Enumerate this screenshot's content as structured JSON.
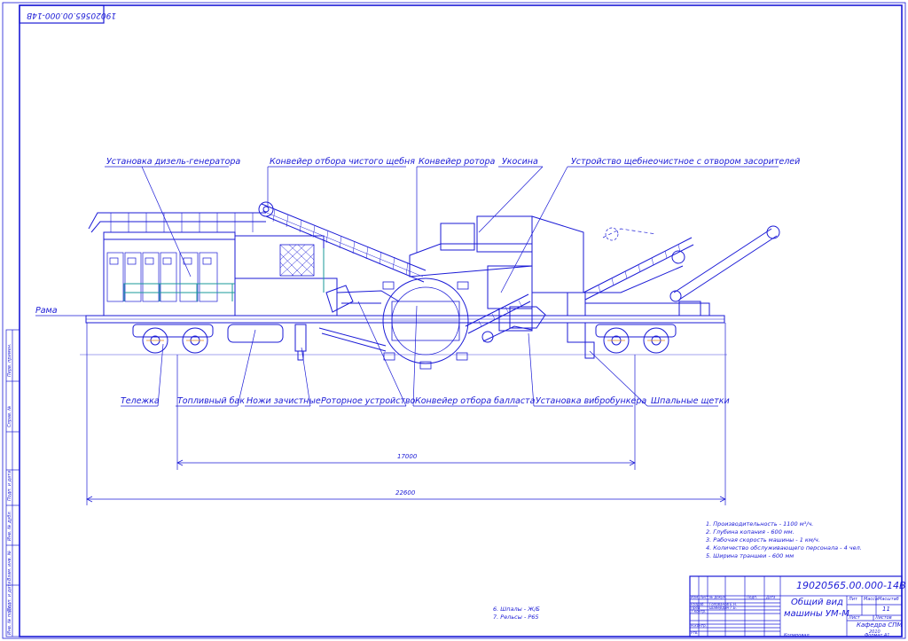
{
  "drawing": {
    "code_top": "19020565.00.000-14В",
    "code_stamp": "19020565.00.000-14В",
    "title_line1": "Общий вид",
    "title_line2": "машины УМ-М",
    "sheet": "11",
    "department": "Кафедра СПМ",
    "year": "2010",
    "copied": "Копировал",
    "format": "Формат  А1",
    "lit_label": "Лит",
    "mass_label": "Масса",
    "scale_label": "Масштаб",
    "list_label": "Лист",
    "lists_label": "Листов",
    "stamp_rows": [
      "Разраб.",
      "Пров.",
      "Т.контр.",
      "Н.контр.",
      "Утв."
    ],
    "stamp_head": [
      "Изм",
      "Лист",
      "№ докум.",
      "Подп.",
      "Дата"
    ],
    "stamp_names": [
      "Голованов Е.Н.",
      "Шабердин Г.Б."
    ]
  },
  "labels": {
    "diesel": "Установка дизель-генератора",
    "clean_conveyor": "Конвейер отбора чистого щебня",
    "rotor_conveyor": "Конвейер ротора",
    "brace": "Укосина",
    "cleaning_device": "Устройство щебнеочистное с отвором засорителей",
    "frame": "Рама",
    "bogie": "Тележка",
    "fuel_tank": "Топливный бак",
    "knives": "Ножи зачистные",
    "rotary_device": "Роторное устройство",
    "ballast_conveyor": "Конвейер отбора балласта",
    "vibro_hopper": "Установка вибробункера",
    "sleeper_brushes": "Шпальные щетки"
  },
  "dimensions": {
    "inner": "17000",
    "outer": "22600"
  },
  "specs": [
    "1. Производительность - 1100 м³/ч.",
    "2. Глубина копания - 600 мм.",
    "3. Рабочая скорость машины - 1 км/ч.",
    "4. Количество обслуживающего персонала - 4 чел.",
    "5. Ширина траншеи - 600 мм"
  ],
  "notes": [
    "6. Шпалы - Ж/Б",
    "7. Рельсы - Р65"
  ],
  "side_stamp": [
    "Перв. примен.",
    "Справ. №",
    "Подп. и дата",
    "Инв. № дубл.",
    "Взам. инв. №",
    "Подп. и дата",
    "Инв. № подл."
  ],
  "colors": {
    "line": "#1a1ad6",
    "accent": "#1a9a9a",
    "paper": "#ffffff"
  }
}
